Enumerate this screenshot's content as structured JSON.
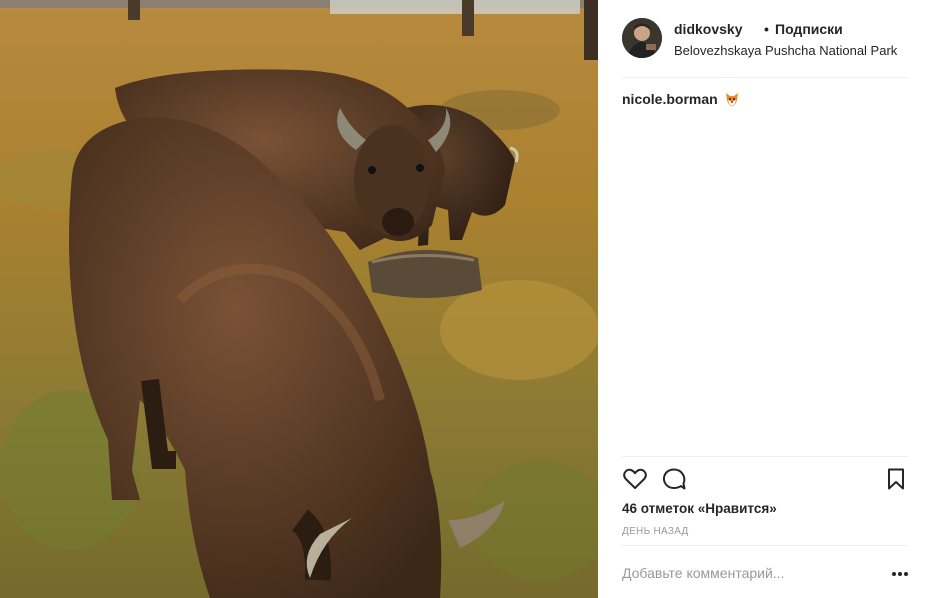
{
  "post": {
    "username": "didkovsky",
    "separator": "•",
    "follow_label": "Подписки",
    "location": "Belovezhskaya Pushcha National Park",
    "caption_user": "nicole.borman",
    "caption_emoji": "fox-face-emoji",
    "likes_text": "46 отметок «Нравится»",
    "time_text": "ДЕНЬ НАЗАД"
  },
  "comment": {
    "placeholder": "Добавьте комментарий..."
  },
  "icons": {
    "like": "heart-icon",
    "comment": "speech-bubble-icon",
    "save": "bookmark-icon",
    "more": "ellipsis-icon"
  },
  "colors": {
    "text": "#262626",
    "muted": "#999999",
    "divider": "#efefef"
  }
}
